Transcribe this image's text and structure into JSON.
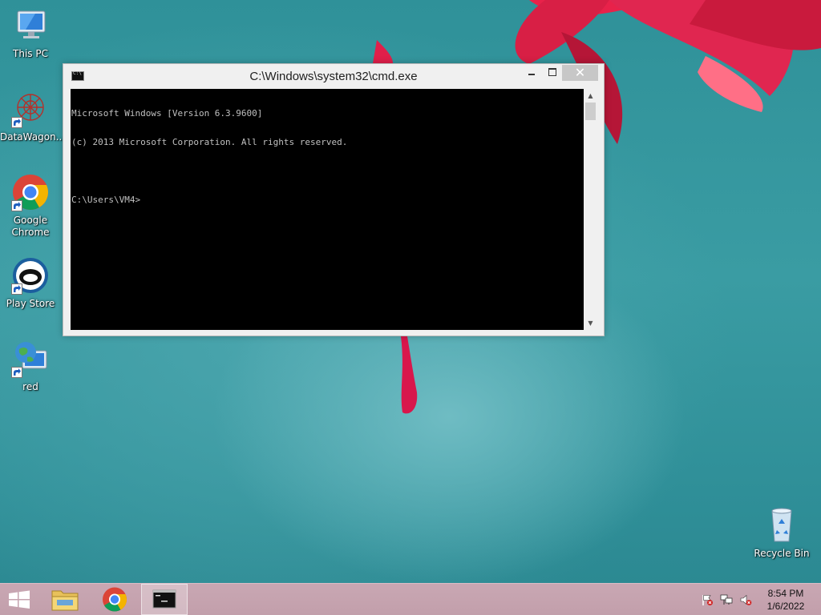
{
  "desktop": {
    "icons": [
      {
        "label": "This PC"
      },
      {
        "label": "DataWagon..."
      },
      {
        "label": "Google\nChrome"
      },
      {
        "label": "Play Store"
      },
      {
        "label": "red"
      },
      {
        "label": "Recycle Bin"
      }
    ]
  },
  "cmd": {
    "title": "C:\\Windows\\system32\\cmd.exe",
    "lines": [
      "Microsoft Windows [Version 6.3.9600]",
      "(c) 2013 Microsoft Corporation. All rights reserved.",
      "",
      "C:\\Users\\VM4>"
    ],
    "close_glyph": "✕"
  },
  "taskbar": {
    "time": "8:54 PM",
    "date": "1/6/2022"
  },
  "icons": {
    "this_pc": "monitor-icon",
    "datawagon": "datawagon-icon",
    "chrome": "chrome-icon",
    "play_store": "play-store-icon",
    "red": "network-globe-icon",
    "recycle_bin": "recycle-bin-icon",
    "start": "windows-logo-icon",
    "explorer": "folder-icon",
    "cmd": "command-prompt-icon",
    "flag": "action-center-flag-icon",
    "network": "network-icon",
    "volume": "volume-muted-icon"
  },
  "colors": {
    "desktop_teal": "#3a9ca3",
    "taskbar": "#c5a3af",
    "console_bg": "#000000",
    "console_text": "#c0c0c0",
    "flower_red": "#d81f45"
  }
}
